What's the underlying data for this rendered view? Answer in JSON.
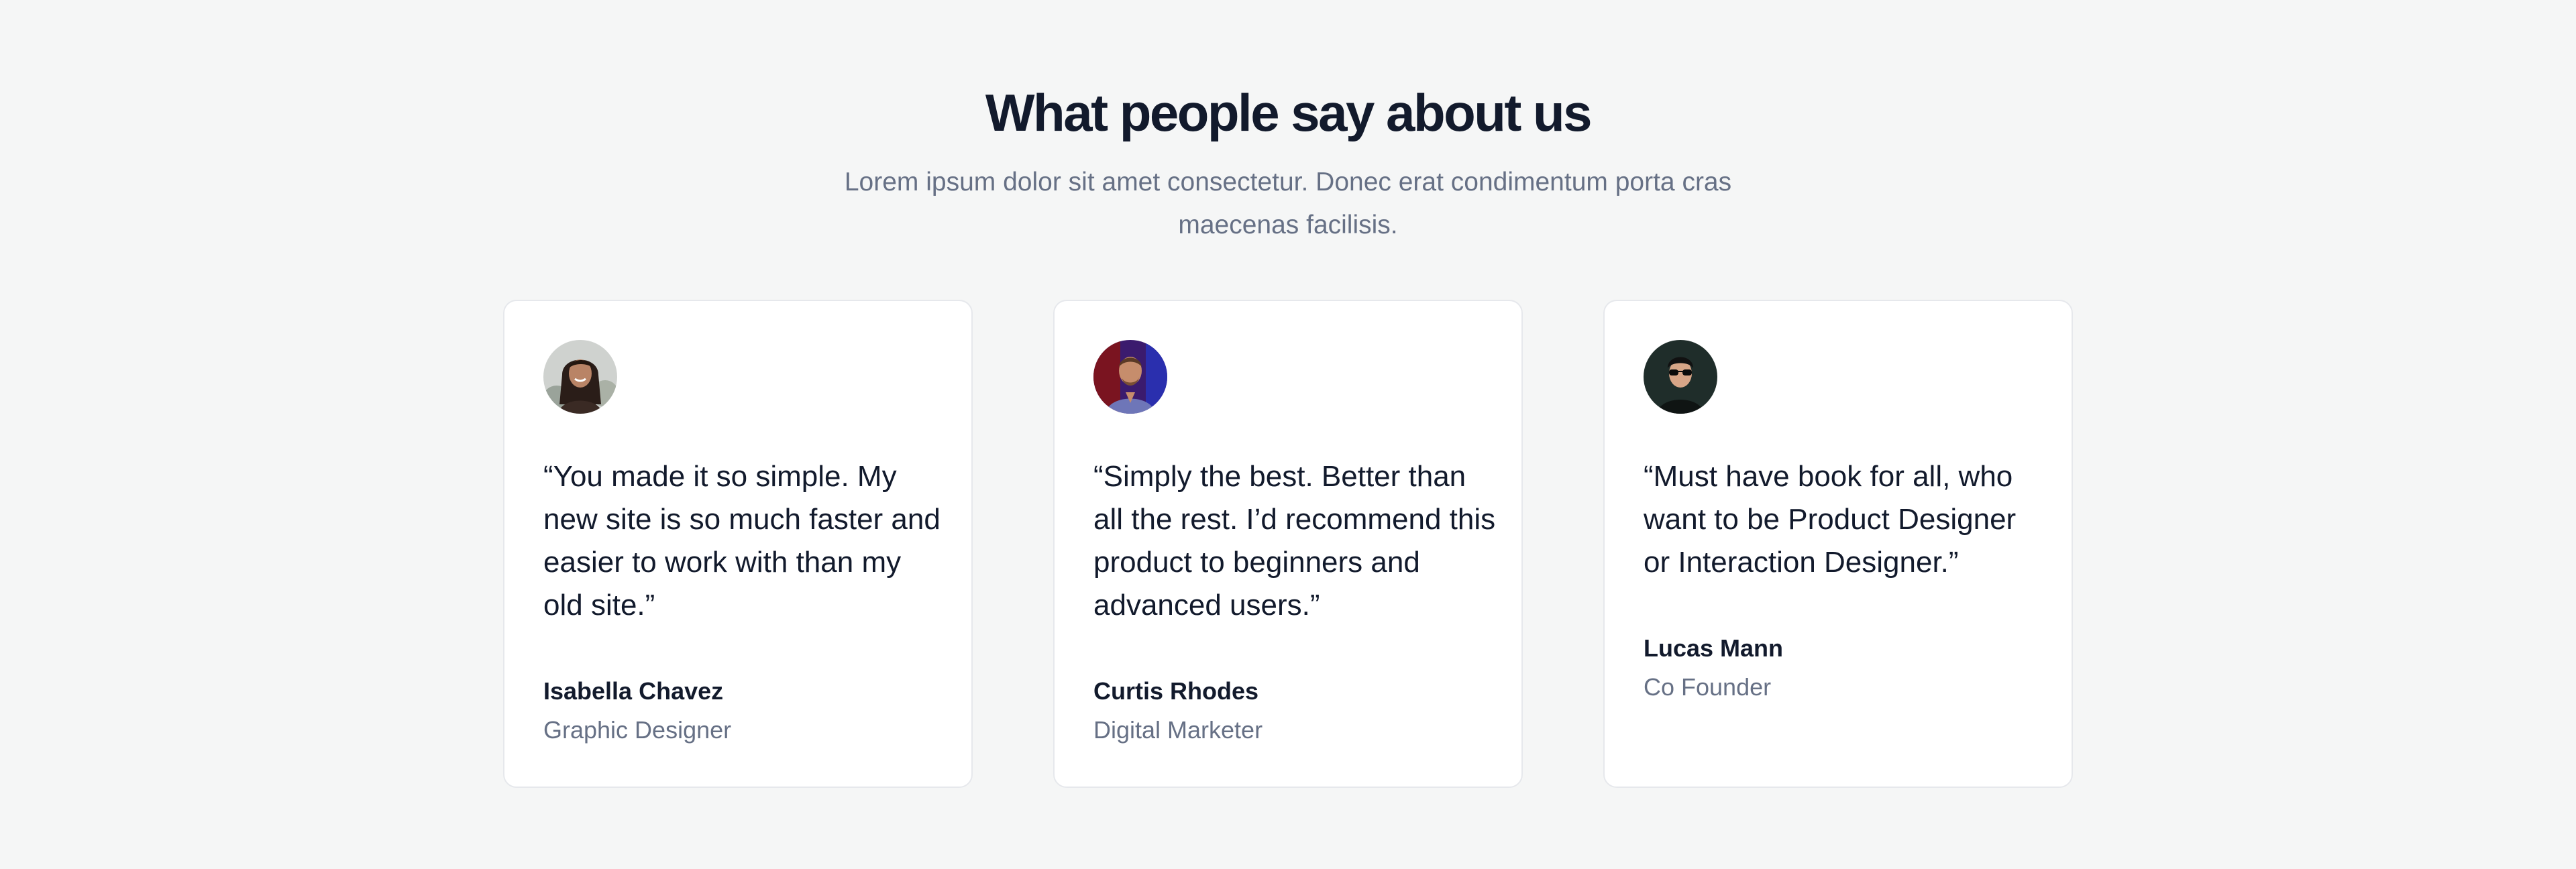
{
  "section": {
    "title": "What people say about us",
    "subtitle": "Lorem ipsum dolor sit amet consectetur. Donec erat condimentum porta cras maecenas facilisis."
  },
  "testimonials": [
    {
      "quote": "“You made it so simple. My new site is so much faster and easier to work with than my old site.”",
      "name": "Isabella Chavez",
      "role": "Graphic Designer",
      "avatar_icon": "avatar-photo-woman"
    },
    {
      "quote": "“Simply the best. Better than all the rest. I’d recommend this product to beginners and advanced users.”",
      "name": "Curtis Rhodes",
      "role": "Digital Marketer",
      "avatar_icon": "avatar-photo-man"
    },
    {
      "quote": "“Must have book for all, who want to be Product Designer or Interaction Designer.”",
      "name": "Lucas Mann",
      "role": "Co Founder",
      "avatar_icon": "avatar-photo-man-sunglasses"
    }
  ],
  "colors": {
    "background": "#f5f6f6",
    "card": "#ffffff",
    "heading": "#121a2c",
    "muted": "#667085",
    "border": "#e6e8ec"
  }
}
